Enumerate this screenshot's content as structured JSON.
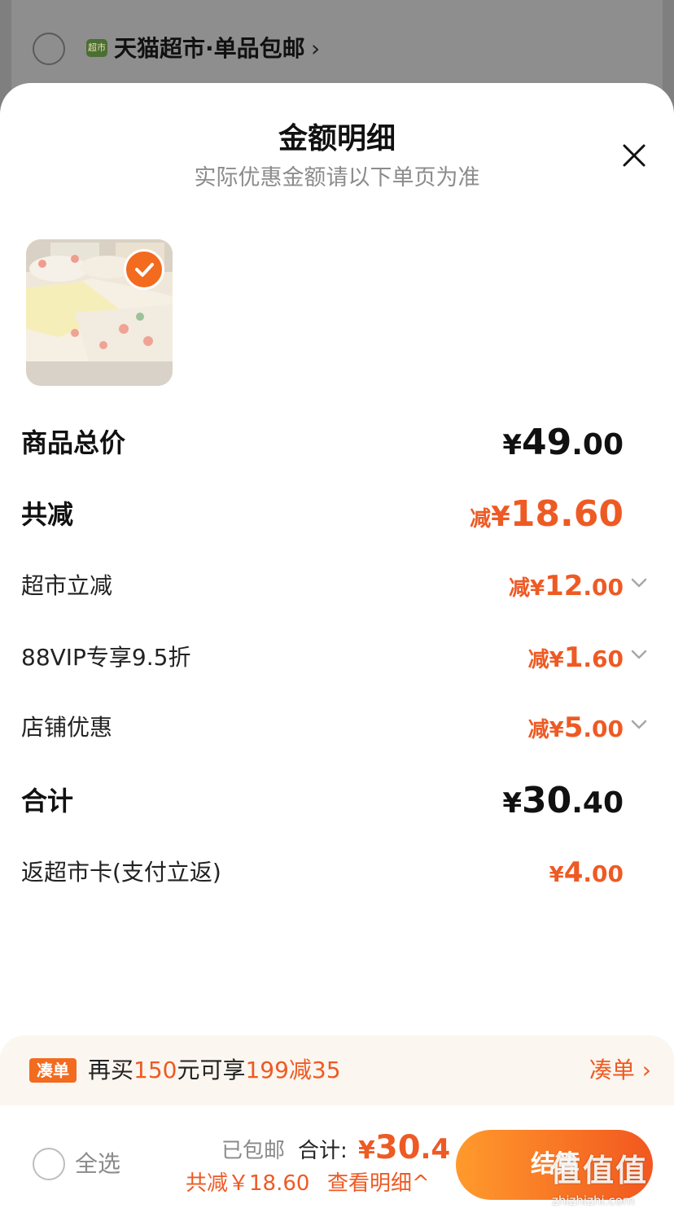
{
  "store": {
    "logo_text": "超市",
    "name": "天猫超市·单品包邮",
    "chevron": "›"
  },
  "sheet": {
    "title": "金额明细",
    "subtitle": "实际优惠金额请以下单页为准"
  },
  "rows": {
    "subtotal": {
      "label": "商品总价",
      "symbol": "¥",
      "int": "49",
      "dec": ".00"
    },
    "discount": {
      "label": "共减",
      "prefix": "减",
      "symbol": "¥",
      "int": "18",
      "dec": ".60"
    },
    "market_cut": {
      "label": "超市立减",
      "prefix": "减",
      "symbol": "¥",
      "int": "12",
      "dec": ".00"
    },
    "vip": {
      "label": "88VIP专享9.5折",
      "prefix": "减",
      "symbol": "¥",
      "int": "1",
      "dec": ".60"
    },
    "store_promo": {
      "label": "店铺优惠",
      "prefix": "减",
      "symbol": "¥",
      "int": "5",
      "dec": ".00"
    },
    "total": {
      "label": "合计",
      "symbol": "¥",
      "int": "30",
      "dec": ".40"
    },
    "cashback": {
      "label": "返超市卡(支付立返)",
      "symbol": "¥",
      "int": "4",
      "dec": ".00"
    }
  },
  "promo": {
    "badge": "凑单",
    "text_1": "再买",
    "amount": "150",
    "text_2": "元可享",
    "offer": "199减35",
    "link": "凑单",
    "link_chevron": "›"
  },
  "bottom": {
    "select_all": "全选",
    "shipping": "已包邮",
    "total_label": "合计:",
    "total_symbol": "¥",
    "total_int": "30",
    "total_dec": ".4",
    "saved": "共减￥18.60",
    "detail_link": "查看明细",
    "detail_caret": "^",
    "checkout": "结算"
  },
  "watermark": {
    "mark": "值值值",
    "url": "zhizhizhi.com"
  },
  "colors": {
    "accent": "#ee5a24",
    "check": "#f26b1f",
    "muted": "#8c8c8c"
  }
}
